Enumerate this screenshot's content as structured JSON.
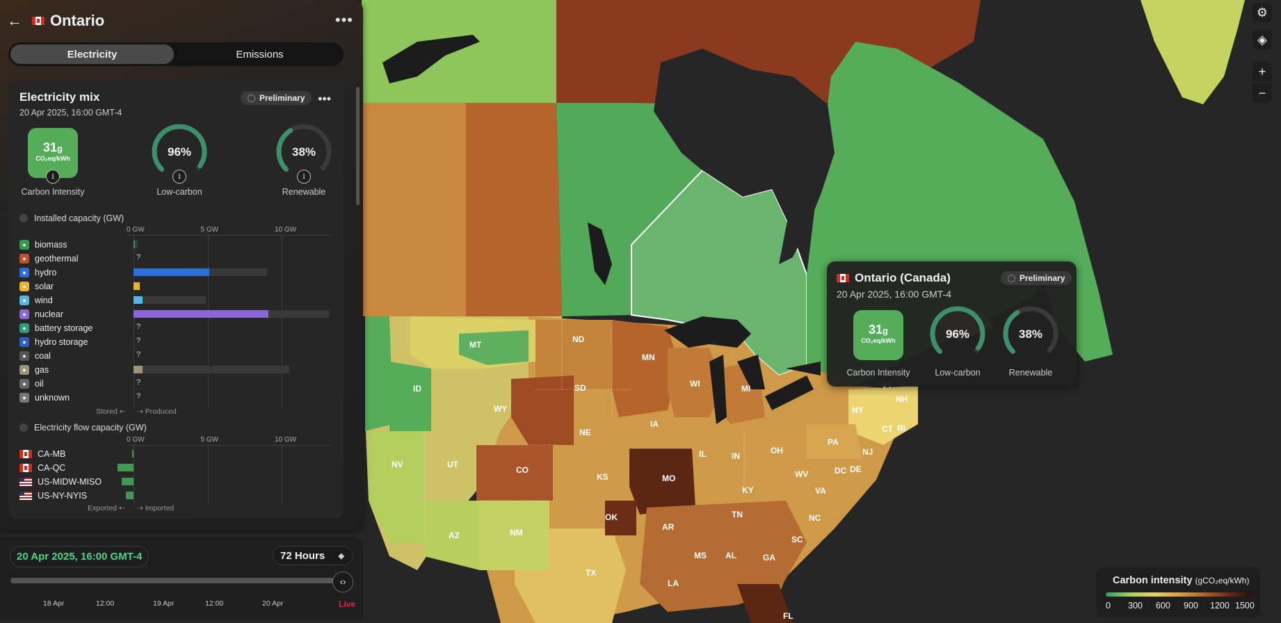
{
  "header": {
    "title": "Ontario",
    "back_icon": "arrow-left-icon",
    "more_icon": "more-horizontal-icon"
  },
  "tabs": [
    {
      "label": "Electricity",
      "active": true
    },
    {
      "label": "Emissions",
      "active": false
    }
  ],
  "mix": {
    "title": "Electricity mix",
    "date": "20 Apr 2025, 16:00 GMT-4",
    "badge": "Preliminary",
    "carbon": {
      "value": "31",
      "unit_g": "g",
      "unit": "CO₂eq/kWh",
      "label": "Carbon Intensity"
    },
    "low_carbon": {
      "value": "96%",
      "fraction": 0.96,
      "label": "Low-carbon"
    },
    "renewable": {
      "value": "38%",
      "fraction": 0.38,
      "label": "Renewable"
    },
    "capacity": {
      "title": "Installed capacity (GW)",
      "ticks": [
        "0 GW",
        "5 GW",
        "10 GW"
      ],
      "stored_label": "Stored ⇠",
      "produced_label": "⇢ Produced",
      "rows": [
        {
          "name": "biomass",
          "color": "#2e9c4c",
          "capacity": 0.3,
          "produced": 0.05,
          "unknown": false
        },
        {
          "name": "geothermal",
          "color": "#c2502f",
          "capacity": 0,
          "produced": 0,
          "unknown": true
        },
        {
          "name": "hydro",
          "color": "#2d6fd6",
          "capacity": 9.0,
          "produced": 5.1,
          "unknown": false
        },
        {
          "name": "solar",
          "color": "#e9b530",
          "capacity": 0.4,
          "produced": 0.4,
          "unknown": false
        },
        {
          "name": "wind",
          "color": "#5ab4e0",
          "capacity": 4.9,
          "produced": 0.6,
          "unknown": false
        },
        {
          "name": "nuclear",
          "color": "#8a66d6",
          "capacity": 13.2,
          "produced": 9.1,
          "unknown": false
        },
        {
          "name": "battery storage",
          "color": "#2e9c7c",
          "capacity": 0,
          "produced": 0,
          "unknown": true
        },
        {
          "name": "hydro storage",
          "color": "#2d5fc6",
          "capacity": 0,
          "produced": 0,
          "unknown": true
        },
        {
          "name": "coal",
          "color": "#555555",
          "capacity": 0,
          "produced": 0,
          "unknown": true
        },
        {
          "name": "gas",
          "color": "#9c9576",
          "capacity": 10.5,
          "produced": 0.6,
          "unknown": false
        },
        {
          "name": "oil",
          "color": "#666666",
          "capacity": 0,
          "produced": 0,
          "unknown": true
        },
        {
          "name": "unknown",
          "color": "#777777",
          "capacity": 0,
          "produced": 0,
          "unknown": true
        }
      ]
    },
    "flow": {
      "title": "Electricity flow capacity (GW)",
      "ticks": [
        "0 GW",
        "5 GW",
        "10 GW"
      ],
      "exported_label": "Exported ⇠",
      "imported_label": "⇢ Imported",
      "rows": [
        {
          "name": "CA-MB",
          "country": "ca",
          "export": 0.08
        },
        {
          "name": "CA-QC",
          "country": "ca",
          "export": 1.1
        },
        {
          "name": "US-MIDW-MISO",
          "country": "us",
          "export": 0.8
        },
        {
          "name": "US-NY-NYIS",
          "country": "us",
          "export": 0.5
        }
      ]
    }
  },
  "timeline": {
    "date": "20 Apr 2025, 16:00 GMT-4",
    "range": "72 Hours",
    "ticks": [
      "18 Apr",
      "12:00",
      "19 Apr",
      "12:00",
      "20 Apr"
    ],
    "live": "Live",
    "position": 1.0
  },
  "tooltip": {
    "title": "Ontario (Canada)",
    "date": "20 Apr 2025, 16:00 GMT-4",
    "badge": "Preliminary",
    "carbon_value": "31",
    "unit_g": "g",
    "carbon_unit": "CO₂eq/kWh",
    "carbon_label": "Carbon Intensity",
    "low_carbon": "96%",
    "low_carbon_label": "Low-carbon",
    "renewable": "38%",
    "renewable_label": "Renewable"
  },
  "controls": {
    "settings_icon": "gear-icon",
    "layers_icon": "layers-icon",
    "zoom_in": "+",
    "zoom_out": "−"
  },
  "legend": {
    "title": "Carbon intensity",
    "unit": "(gCO₂eq/kWh)",
    "labels": [
      "0",
      "300",
      "600",
      "900",
      "1200",
      "1500"
    ]
  },
  "map_labels": [
    "MT",
    "ND",
    "MN",
    "WI",
    "MI",
    "SD",
    "ID",
    "WY",
    "NE",
    "IA",
    "IL",
    "IN",
    "OH",
    "PA",
    "NY",
    "NH",
    "VT",
    "NJ",
    "CO",
    "UT",
    "NV",
    "KS",
    "MO",
    "KY",
    "WV",
    "DC",
    "DE",
    "VA",
    "NC",
    "TN",
    "OK",
    "AR",
    "SC",
    "NM",
    "AZ",
    "MS",
    "AL",
    "GA",
    "TX",
    "LA",
    "FL",
    "CT",
    "RI"
  ]
}
